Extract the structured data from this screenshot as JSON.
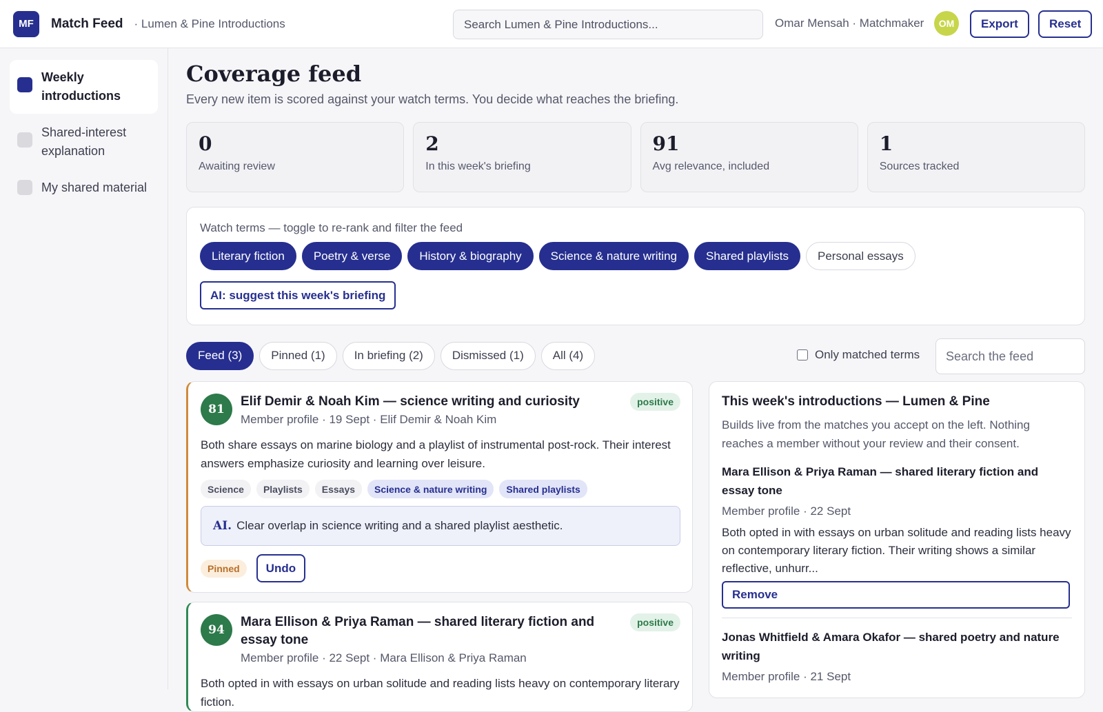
{
  "app": {
    "logo_text": "MF",
    "title": "Match Feed",
    "org": "· Lumen & Pine Introductions",
    "search_placeholder": "Search Lumen & Pine Introductions...",
    "user": "Omar Mensah · Matchmaker",
    "avatar_initials": "OM",
    "export_label": "Export",
    "reset_label": "Reset"
  },
  "sidebar": {
    "items": [
      {
        "label": "Weekly introductions",
        "active": true
      },
      {
        "label": "Shared-interest explanation",
        "active": false
      },
      {
        "label": "My shared material",
        "active": false
      }
    ]
  },
  "page": {
    "title": "Coverage feed",
    "subtitle": "Every new item is scored against your watch terms. You decide what reaches the briefing."
  },
  "stats": [
    {
      "value": "0",
      "label": "Awaiting review"
    },
    {
      "value": "2",
      "label": "In this week's briefing"
    },
    {
      "value": "91",
      "label": "Avg relevance, included"
    },
    {
      "value": "1",
      "label": "Sources tracked"
    }
  ],
  "watch": {
    "label": "Watch terms — toggle to re-rank and filter the feed",
    "terms": [
      {
        "label": "Literary fiction",
        "on": true
      },
      {
        "label": "Poetry & verse",
        "on": true
      },
      {
        "label": "History & biography",
        "on": true
      },
      {
        "label": "Science & nature writing",
        "on": true
      },
      {
        "label": "Shared playlists",
        "on": true
      },
      {
        "label": "Personal essays",
        "on": false
      }
    ],
    "ai_button": "AI: suggest this week's briefing"
  },
  "tabs": {
    "items": [
      {
        "label": "Feed (3)",
        "on": true
      },
      {
        "label": "Pinned (1)",
        "on": false
      },
      {
        "label": "In briefing (2)",
        "on": false
      },
      {
        "label": "Dismissed (1)",
        "on": false
      },
      {
        "label": "All (4)",
        "on": false
      }
    ],
    "only_matched_label": "Only matched terms",
    "only_matched_checked": false,
    "search_placeholder": "Search the feed"
  },
  "feed": [
    {
      "score": "81",
      "title": "Elif Demir & Noah Kim — science writing and curiosity",
      "meta": "Member profile · 19 Sept · Elif Demir & Noah Kim",
      "sentiment": "positive",
      "body": "Both share essays on marine biology and a playlist of instrumental post-rock. Their interest answers emphasize curiosity and learning over leisure.",
      "tags": [
        "Science",
        "Playlists",
        "Essays"
      ],
      "matched_tags": [
        "Science & nature writing",
        "Shared playlists"
      ],
      "ai_prefix": "AI.",
      "ai_note": "Clear overlap in science writing and a shared playlist aesthetic.",
      "status": "Pinned",
      "action": "Undo"
    },
    {
      "score": "94",
      "title": "Mara Ellison & Priya Raman — shared literary fiction and essay tone",
      "meta": "Member profile · 22 Sept · Mara Ellison & Priya Raman",
      "sentiment": "positive",
      "body": "Both opted in with essays on urban solitude and reading lists heavy on contemporary literary fiction."
    }
  ],
  "briefing": {
    "title": "This week's introductions — Lumen & Pine",
    "subtitle": "Builds live from the matches you accept on the left. Nothing reaches a member without your review and their consent.",
    "items": [
      {
        "title": "Mara Ellison & Priya Raman — shared literary fiction and essay tone",
        "meta": "Member profile · 22 Sept",
        "body": "Both opted in with essays on urban solitude and reading lists heavy on contemporary literary fiction. Their writing shows a similar reflective, unhurr...",
        "action": "Remove"
      },
      {
        "title": "Jonas Whitfield & Amara Okafor — shared poetry and nature writing",
        "meta": "Member profile · 21 Sept"
      }
    ]
  },
  "colors": {
    "accent": "#262f8f",
    "positive": "#2d7a4a",
    "pinned": "#d08a3a",
    "avatar": "#c7d54a"
  }
}
